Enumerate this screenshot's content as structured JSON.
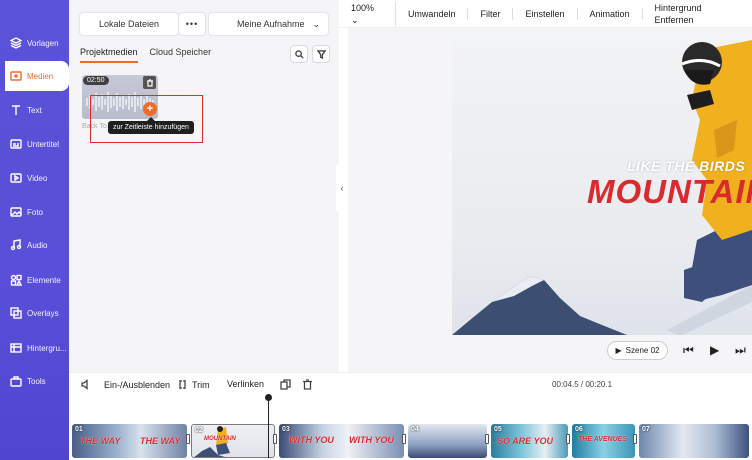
{
  "sidebar": {
    "items": [
      {
        "label": "Vorlagen",
        "icon": "templates-icon"
      },
      {
        "label": "Medien",
        "icon": "media-icon",
        "active": true
      },
      {
        "label": "Text",
        "icon": "text-icon"
      },
      {
        "label": "Untertitel",
        "icon": "subtitles-icon"
      },
      {
        "label": "Video",
        "icon": "video-icon"
      },
      {
        "label": "Foto",
        "icon": "photo-icon"
      },
      {
        "label": "Audio",
        "icon": "audio-icon"
      },
      {
        "label": "Elemente",
        "icon": "elements-icon"
      },
      {
        "label": "Overlays",
        "icon": "overlays-icon"
      },
      {
        "label": "Hintergru...",
        "icon": "background-icon"
      },
      {
        "label": "Tools",
        "icon": "tools-icon"
      }
    ]
  },
  "media": {
    "local_files": "Lokale Dateien",
    "more": "•••",
    "my_recording": "Meine Aufnahme",
    "tabs": [
      "Projektmedien",
      "Cloud Speicher"
    ],
    "clip": {
      "duration": "02:50",
      "name": "Back To..."
    },
    "tooltip": "zur Zeitleiste hinzufügen"
  },
  "toolbar": {
    "zoom": "100%",
    "items": [
      "Umwandeln",
      "Filter",
      "Einstellen",
      "Animation",
      "Hintergrund Entfernen"
    ]
  },
  "preview": {
    "line1": "LIKE THE BIRDS",
    "line2": "MOUNTAIN",
    "scene_label": "Szene 02"
  },
  "timeline": {
    "fade": "Ein-/Ausblenden",
    "trim": "Trim",
    "link": "Verlinken",
    "timecode": "00:04.5 / 00:20.1",
    "scenes": [
      {
        "num": "01",
        "text": "THE WAY"
      },
      {
        "num": "02",
        "text": "MOUNTAIN"
      },
      {
        "num": "03",
        "text": "WITH YOU"
      },
      {
        "num": "04",
        "text": ""
      },
      {
        "num": "05",
        "text": "SO ARE YOU"
      },
      {
        "num": "06",
        "text": "THE AVENUES"
      },
      {
        "num": "07",
        "text": ""
      }
    ]
  },
  "colors": {
    "accent": "#f06a2a",
    "sidebar": "#5a52d9",
    "title_red": "#d92a2e"
  }
}
